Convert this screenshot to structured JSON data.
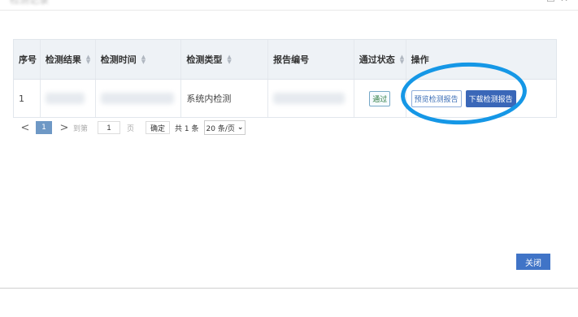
{
  "dialog": {
    "title": "检测记录",
    "close_label": "关闭"
  },
  "table": {
    "headers": {
      "seq": "序号",
      "result": "检测结果",
      "time": "检测时间",
      "type": "检测类型",
      "report_no": "报告编号",
      "status": "通过状态",
      "actions": "操作"
    },
    "rows": [
      {
        "seq": "1",
        "type": "系统内检测",
        "status": "通过",
        "preview_label": "预览检测报告",
        "download_label": "下载检测报告"
      }
    ]
  },
  "pagination": {
    "prev": "<",
    "current_page": "1",
    "next": ">",
    "goto_label": "到第",
    "goto_value": "1",
    "page_unit": "页",
    "confirm_label": "确定",
    "total_text": "共 1 条",
    "page_size": "20 条/页",
    "page_size_arrow": "⌄"
  },
  "colors": {
    "primary": "#4074c7",
    "annotation_circle": "#1597e6",
    "header_bg": "#eef2f6"
  }
}
